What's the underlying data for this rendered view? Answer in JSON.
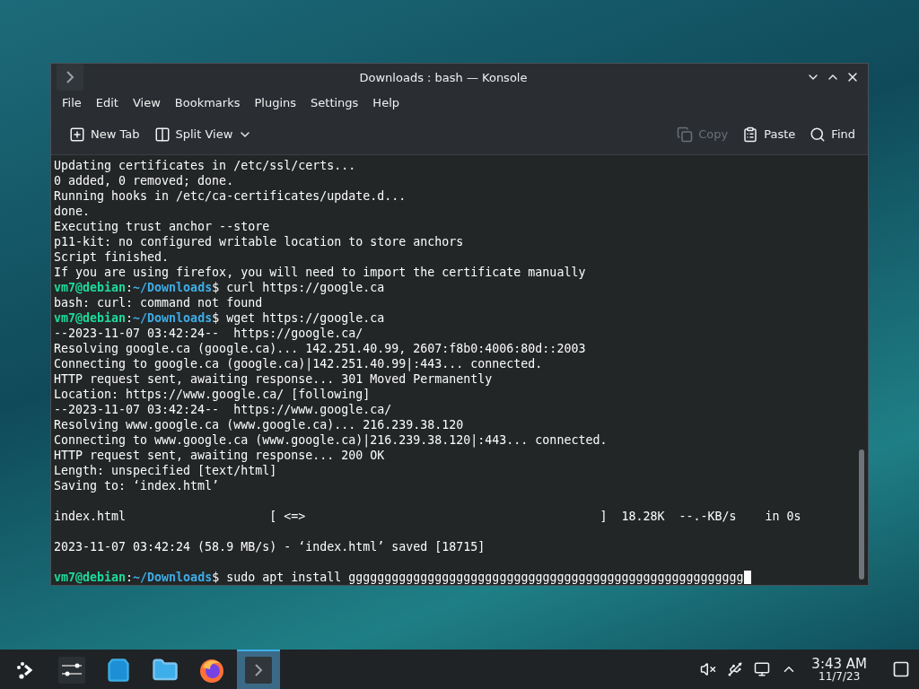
{
  "window": {
    "title": "Downloads : bash — Konsole"
  },
  "menu": [
    "File",
    "Edit",
    "View",
    "Bookmarks",
    "Plugins",
    "Settings",
    "Help"
  ],
  "toolbar": {
    "left": [
      {
        "kind": "newtab",
        "label": "New Tab",
        "disabled": false
      },
      {
        "kind": "split",
        "label": "Split View",
        "disabled": false
      }
    ],
    "right": [
      {
        "kind": "copy",
        "label": "Copy",
        "disabled": true
      },
      {
        "kind": "paste",
        "label": "Paste",
        "disabled": false
      },
      {
        "kind": "find",
        "label": "Find",
        "disabled": false
      }
    ]
  },
  "terminal": [
    {
      "kind": "output",
      "text": "Updating certificates in /etc/ssl/certs..."
    },
    {
      "kind": "output",
      "text": "0 added, 0 removed; done."
    },
    {
      "kind": "output",
      "text": "Running hooks in /etc/ca-certificates/update.d..."
    },
    {
      "kind": "output",
      "text": "done."
    },
    {
      "kind": "output",
      "text": "Executing trust anchor --store"
    },
    {
      "kind": "output",
      "text": "p11-kit: no configured writable location to store anchors"
    },
    {
      "kind": "output",
      "text": "Script finished."
    },
    {
      "kind": "output",
      "text": "If you are using firefox, you will need to import the certificate manually"
    },
    {
      "kind": "prompt",
      "user": "vm7@debian",
      "colon": ":",
      "path": "~/Downloads",
      "sign": "$",
      "command": "curl https://google.ca"
    },
    {
      "kind": "output",
      "text": "bash: curl: command not found"
    },
    {
      "kind": "prompt",
      "user": "vm7@debian",
      "colon": ":",
      "path": "~/Downloads",
      "sign": "$",
      "command": "wget https://google.ca"
    },
    {
      "kind": "output",
      "text": "--2023-11-07 03:42:24--  https://google.ca/"
    },
    {
      "kind": "output",
      "text": "Resolving google.ca (google.ca)... 142.251.40.99, 2607:f8b0:4006:80d::2003"
    },
    {
      "kind": "output",
      "text": "Connecting to google.ca (google.ca)|142.251.40.99|:443... connected."
    },
    {
      "kind": "output",
      "text": "HTTP request sent, awaiting response... 301 Moved Permanently"
    },
    {
      "kind": "output",
      "text": "Location: https://www.google.ca/ [following]"
    },
    {
      "kind": "output",
      "text": "--2023-11-07 03:42:24--  https://www.google.ca/"
    },
    {
      "kind": "output",
      "text": "Resolving www.google.ca (www.google.ca)... 216.239.38.120"
    },
    {
      "kind": "output",
      "text": "Connecting to www.google.ca (www.google.ca)|216.239.38.120|:443... connected."
    },
    {
      "kind": "output",
      "text": "HTTP request sent, awaiting response... 200 OK"
    },
    {
      "kind": "output",
      "text": "Length: unspecified [text/html]"
    },
    {
      "kind": "output",
      "text": "Saving to: ‘index.html’"
    },
    {
      "kind": "blank"
    },
    {
      "kind": "output",
      "text": "index.html                    [ <=>                                         ]  18.28K  --.-KB/s    in 0s"
    },
    {
      "kind": "blank"
    },
    {
      "kind": "output",
      "text": "2023-11-07 03:42:24 (58.9 MB/s) - ‘index.html’ saved [18715]"
    },
    {
      "kind": "blank"
    },
    {
      "kind": "prompt",
      "user": "vm7@debian",
      "colon": ":",
      "path": "~/Downloads",
      "sign": "$",
      "command": "sudo apt install ggggggggggggggggggggggggggggggggggggggggggggggggggggggg",
      "cursor": true
    }
  ],
  "taskbar": {
    "items": [
      {
        "kind": "launcher",
        "selected": false
      },
      {
        "kind": "settings",
        "selected": false
      },
      {
        "kind": "store",
        "selected": false
      },
      {
        "kind": "files",
        "selected": false
      },
      {
        "kind": "firefox",
        "selected": false
      },
      {
        "kind": "terminal",
        "selected": true
      }
    ],
    "tray": [
      {
        "kind": "mute"
      },
      {
        "kind": "usb"
      },
      {
        "kind": "network"
      },
      {
        "kind": "expand"
      }
    ],
    "time": "3:43 AM",
    "date": "11/7/23"
  }
}
